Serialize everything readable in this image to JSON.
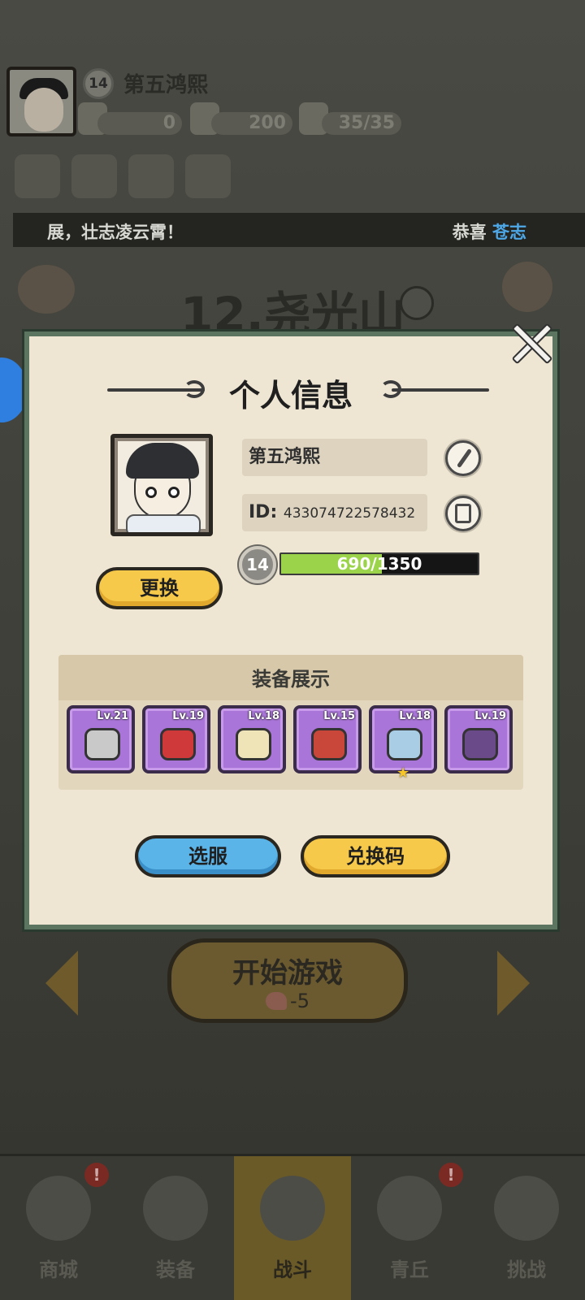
{
  "hud": {
    "level": "14",
    "player_name": "第五鸿熙",
    "resources": [
      {
        "icon": "scroll-plus-icon",
        "value": "0"
      },
      {
        "icon": "jade-dragon-plus-icon",
        "value": "200"
      },
      {
        "icon": "peach-plus-icon",
        "value": "35/35"
      }
    ]
  },
  "ticker": {
    "left_text": "展，壮志凌云霄！",
    "right_prefix": "恭喜",
    "right_name": "苍志"
  },
  "stage": {
    "title": "12.尧光山"
  },
  "start_button": {
    "label": "开始游戏",
    "cost": "-5"
  },
  "bottom_nav": [
    {
      "label": "商城",
      "icon": "shop-icon",
      "badge": "!"
    },
    {
      "label": "装备",
      "icon": "equipment-icon"
    },
    {
      "label": "战斗",
      "icon": "crossed-swords-icon"
    },
    {
      "label": "青丘",
      "icon": "mountain-icon",
      "badge": "!"
    },
    {
      "label": "挑战",
      "icon": "challenge-icon"
    }
  ],
  "modal": {
    "title": "个人信息",
    "name": "第五鸿熙",
    "id_label": "ID:",
    "id_value": "433074722578432",
    "level": "14",
    "xp": {
      "current": 690,
      "max": 1350,
      "text": "690/1350"
    },
    "change_button": "更换",
    "equipment_title": "装备展示",
    "equipment": [
      {
        "level": "Lv.21",
        "icon": "hammer-icon",
        "color": "#c9c9c9"
      },
      {
        "level": "Lv.19",
        "icon": "red-helmet-icon",
        "color": "#d0393a"
      },
      {
        "level": "Lv.18",
        "icon": "bone-bracer-icon",
        "color": "#efe3b8"
      },
      {
        "level": "Lv.15",
        "icon": "red-belt-icon",
        "color": "#c8473a"
      },
      {
        "level": "Lv.18",
        "icon": "armored-boots-icon",
        "color": "#a9cde5",
        "starred": true
      },
      {
        "level": "Lv.19",
        "icon": "orb-amulet-icon",
        "color": "#6b4a8a"
      }
    ],
    "select_server_button": "选服",
    "redeem_code_button": "兑换码"
  }
}
